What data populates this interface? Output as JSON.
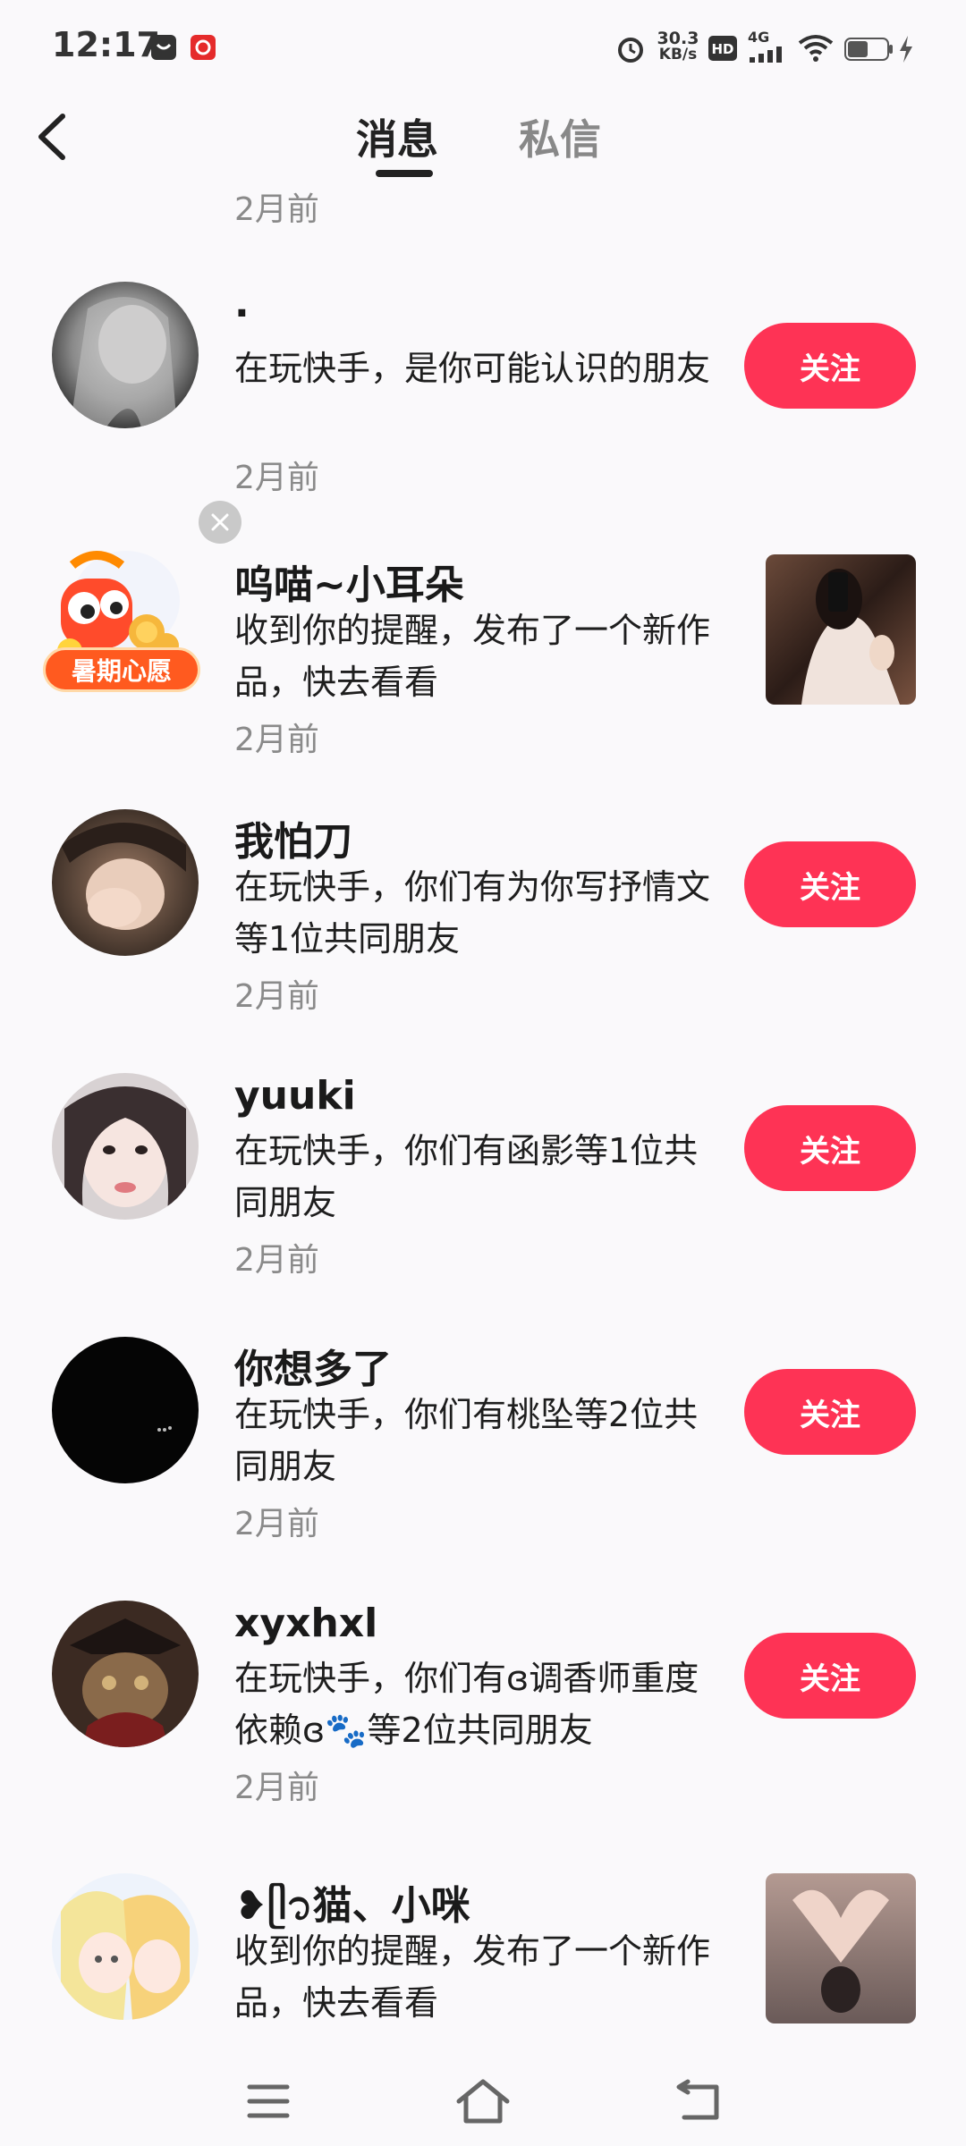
{
  "status_bar": {
    "time": "12:17",
    "net_speed_value": "30.3",
    "net_speed_unit": "KB/s",
    "hd_label": "HD",
    "network_label": "4G"
  },
  "header": {
    "tabs": [
      {
        "label": "消息",
        "active": true
      },
      {
        "label": "私信",
        "active": false
      }
    ]
  },
  "feed": {
    "top_time": "2月前",
    "items": [
      {
        "name": "·",
        "desc": "在玩快手，是你可能认识的朋友",
        "time": "2月前",
        "action": "关注"
      },
      {
        "name": "呜喵~小耳朵",
        "desc": "收到你的提醒，发布了一个新作品，快去看看",
        "time": "2月前",
        "badge": "暑期心愿"
      },
      {
        "name": "我怕刀",
        "desc": "在玩快手，你们有为你写抒情文等1位共同朋友",
        "time": "2月前",
        "action": "关注"
      },
      {
        "name": "yuuki",
        "desc": "在玩快手，你们有函影等1位共同朋友",
        "time": "2月前",
        "action": "关注"
      },
      {
        "name": "你想多了",
        "desc": "在玩快手，你们有桃坠等2位共同朋友",
        "time": "2月前",
        "action": "关注"
      },
      {
        "name": "xyxhxl",
        "desc": "在玩快手，你们有ɞ调香师重度依赖ɞ🐾等2位共同朋友",
        "time": "2月前",
        "action": "关注"
      },
      {
        "name": "❥ᥫ᭡猫、小咪",
        "desc": "收到你的提醒，发布了一个新作品，快去看看"
      }
    ]
  },
  "colors": {
    "accent": "#fe3355",
    "background": "#faf9fb",
    "muted_text": "#8a8a8a"
  },
  "nav_bar": {
    "icons": [
      "menu-icon",
      "home-icon",
      "back-icon"
    ]
  }
}
